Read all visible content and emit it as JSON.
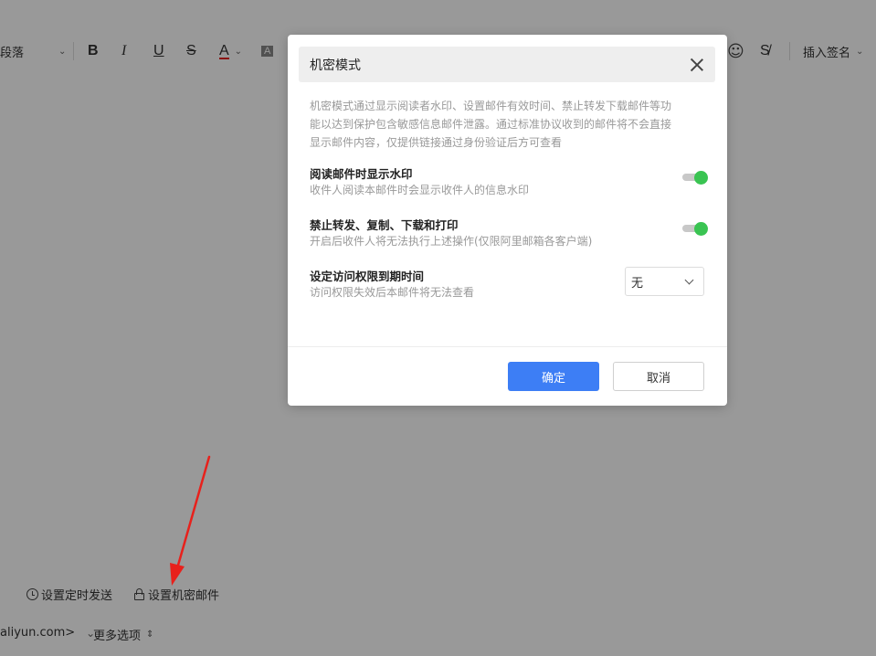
{
  "toolbar": {
    "paragraph_label": "段落",
    "bold_label": "B",
    "italic_label": "I",
    "underline_label": "U",
    "strike_label": "S",
    "font_color_label": "A",
    "highlight_label": "A",
    "insert_signature_label": "插入签名"
  },
  "footer": {
    "schedule_send_label": "设置定时发送",
    "confidential_mail_label": "设置机密邮件",
    "sender_partial": "aliyun.com>",
    "more_options_label": "更多选项"
  },
  "modal": {
    "title": "机密模式",
    "description": "机密模式通过显示阅读者水印、设置邮件有效时间、禁止转发下载邮件等功能以达到保护包含敏感信息邮件泄露。通过标准协议收到的邮件将不会直接显示邮件内容，仅提供链接通过身份验证后方可查看",
    "options": [
      {
        "title": "阅读邮件时显示水印",
        "subtitle": "收件人阅读本邮件时会显示收件人的信息水印",
        "enabled": true
      },
      {
        "title": "禁止转发、复制、下载和打印",
        "subtitle": "开启后收件人将无法执行上述操作(仅限阿里邮箱各客户端)",
        "enabled": true
      }
    ],
    "expiry": {
      "title": "设定访问权限到期时间",
      "subtitle": "访问权限失效后本邮件将无法查看",
      "selected": "无"
    },
    "confirm_label": "确定",
    "cancel_label": "取消"
  },
  "colors": {
    "primary": "#3d7ef5",
    "toggle_on": "#3ac452",
    "arrow": "#e8211c"
  }
}
